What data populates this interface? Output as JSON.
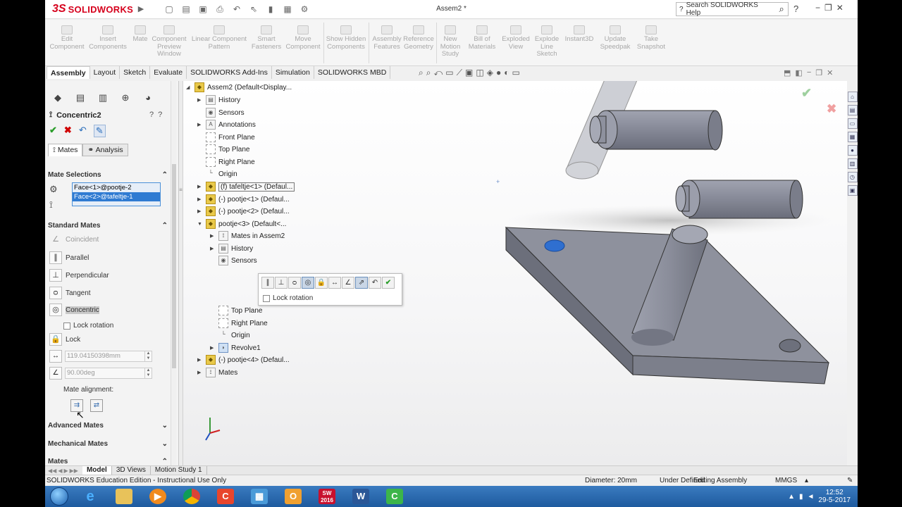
{
  "app": {
    "logo_text": "SOLIDWORKS",
    "document_title": "Assem2 *",
    "search_placeholder": "Search SOLIDWORKS Help",
    "help_label": "?"
  },
  "ribbon": {
    "buttons": [
      {
        "label": "Edit Component"
      },
      {
        "label": "Insert Components"
      },
      {
        "label": "Mate"
      },
      {
        "label": "Component Preview Window"
      },
      {
        "label": "Linear Component Pattern"
      },
      {
        "label": "Smart Fasteners"
      },
      {
        "label": "Move Component"
      },
      {
        "label": "Show Hidden Components"
      },
      {
        "label": "Assembly Features"
      },
      {
        "label": "Reference Geometry"
      },
      {
        "label": "New Motion Study"
      },
      {
        "label": "Bill of Materials"
      },
      {
        "label": "Exploded View"
      },
      {
        "label": "Explode Line Sketch"
      },
      {
        "label": "Instant3D"
      },
      {
        "label": "Update Speedpak"
      },
      {
        "label": "Take Snapshot"
      }
    ]
  },
  "command_tabs": [
    {
      "label": "Assembly"
    },
    {
      "label": "Layout"
    },
    {
      "label": "Sketch"
    },
    {
      "label": "Evaluate"
    },
    {
      "label": "SOLIDWORKS Add-Ins"
    },
    {
      "label": "Simulation"
    },
    {
      "label": "SOLIDWORKS MBD"
    }
  ],
  "property_manager": {
    "title": "Concentric2",
    "tabs": {
      "mates": "Mates",
      "analysis": "Analysis"
    },
    "mate_selections": {
      "header": "Mate Selections",
      "items": [
        "Face<1>@pootje-2",
        "Face<2>@tafeltje-1"
      ]
    },
    "standard_mates": {
      "header": "Standard Mates",
      "items": [
        {
          "label": "Coincident"
        },
        {
          "label": "Parallel"
        },
        {
          "label": "Perpendicular"
        },
        {
          "label": "Tangent"
        },
        {
          "label": "Concentric"
        }
      ],
      "lock_rotation": "Lock rotation",
      "lock": "Lock",
      "distance_value": "119.04150398mm",
      "angle_value": "90.00deg",
      "alignment_label": "Mate alignment:"
    },
    "advanced_mates": "Advanced Mates",
    "mechanical_mates": "Mechanical Mates",
    "mates_section": "Mates"
  },
  "feature_tree": {
    "items": [
      {
        "label": "Assem2  (Default<Display...",
        "icon": "assembly-icon"
      },
      {
        "label": "History",
        "icon": "history-icon"
      },
      {
        "label": "Sensors",
        "icon": "sensors-icon"
      },
      {
        "label": "Annotations",
        "icon": "annotations-icon"
      },
      {
        "label": "Front Plane",
        "icon": "plane-icon"
      },
      {
        "label": "Top Plane",
        "icon": "plane-icon"
      },
      {
        "label": "Right Plane",
        "icon": "plane-icon"
      },
      {
        "label": "Origin",
        "icon": "origin-icon"
      },
      {
        "label": "(f) tafeltje<1> (Defaul...",
        "icon": "part-icon"
      },
      {
        "label": "(-) pootje<1> (Defaul...",
        "icon": "part-icon"
      },
      {
        "label": "(-) pootje<2> (Defaul...",
        "icon": "part-icon"
      },
      {
        "label": "pootje<3> (Default<...",
        "icon": "part-icon"
      },
      {
        "label": "Mates in Assem2",
        "icon": "mates-icon"
      },
      {
        "label": "History",
        "icon": "history-icon"
      },
      {
        "label": "Sensors",
        "icon": "sensors-icon"
      },
      {
        "label": "Top Plane",
        "icon": "plane-icon"
      },
      {
        "label": "Right Plane",
        "icon": "plane-icon"
      },
      {
        "label": "Origin",
        "icon": "origin-icon"
      },
      {
        "label": "Revolve1",
        "icon": "revolve-icon"
      },
      {
        "label": "(-) pootje<4> (Defaul...",
        "icon": "part-icon"
      },
      {
        "label": "Mates",
        "icon": "mates-icon"
      }
    ]
  },
  "popup": {
    "lock_rotation": "Lock rotation"
  },
  "bottom_tabs": [
    {
      "label": "Model"
    },
    {
      "label": "3D Views"
    },
    {
      "label": "Motion Study 1"
    }
  ],
  "status": {
    "edition": "SOLIDWORKS Education Edition - Instructional Use Only",
    "diameter": "Diameter: 20mm",
    "definition": "Under Defined",
    "mode": "Editing Assembly",
    "units": "MMGS"
  },
  "taskbar": {
    "time": "12:52",
    "date": "29-5-2017",
    "apps": [
      "internet-explorer",
      "file-explorer",
      "media-player",
      "chrome",
      "ccleaner",
      "control-panel",
      "outlook",
      "solidworks-2016",
      "word",
      "camtasia"
    ],
    "sw_badge": "2016"
  },
  "colors": {
    "accent": "#2f7bd2",
    "brand": "#d6001c",
    "part_gray": "#8e929f"
  }
}
